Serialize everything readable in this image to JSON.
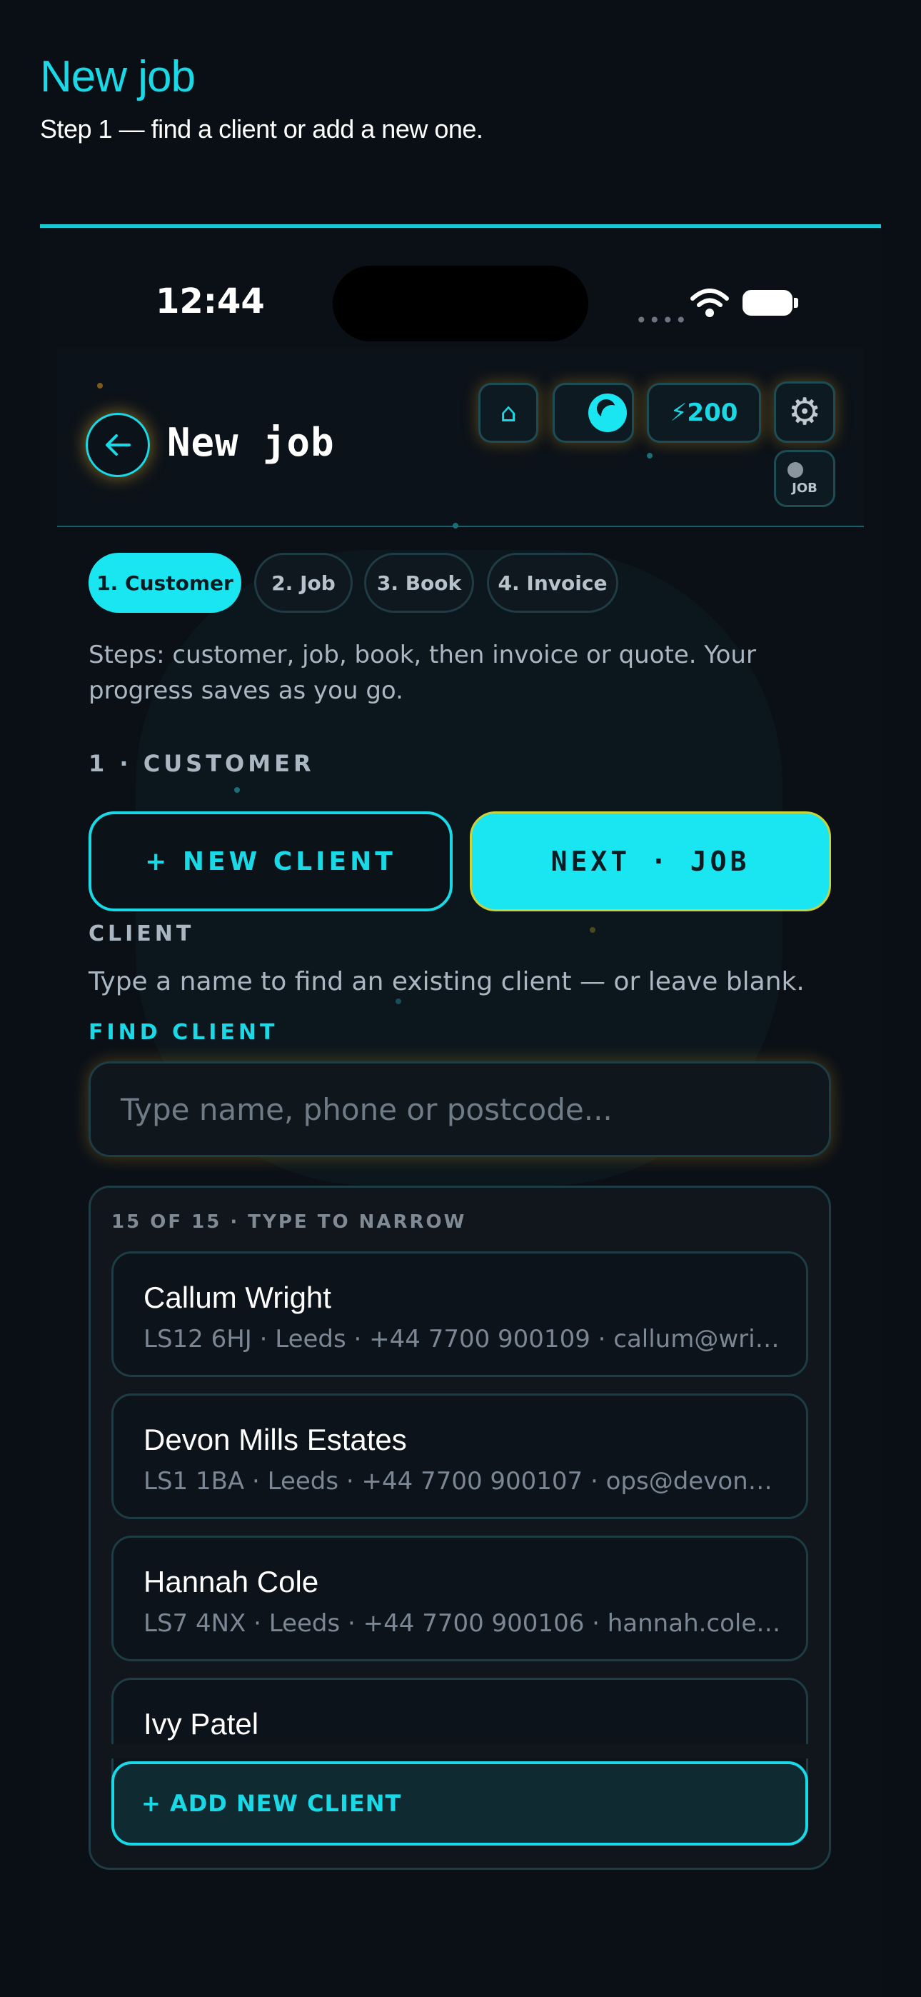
{
  "doc": {
    "title": "New job",
    "subtitle": "Step 1 — find a client or add a new one."
  },
  "status_bar": {
    "time": "12:44",
    "signal": "••••"
  },
  "header": {
    "title": "New job",
    "home_icon": "⌂",
    "credits": "⚡200",
    "gear_icon": "⚙",
    "job_toggle_label": "JOB"
  },
  "steps": {
    "items": [
      "1. Customer",
      "2. Job",
      "3. Book",
      "4. Invoice"
    ],
    "active_index": 0,
    "description": "Steps: customer, job, book, then invoice or quote. Your progress saves as you go."
  },
  "section": {
    "label": "1 · CUSTOMER"
  },
  "actions": {
    "new_client": "+ NEW CLIENT",
    "next": "NEXT · JOB"
  },
  "client": {
    "label": "CLIENT",
    "help": "Type a name to find an existing client — or leave blank.",
    "find_label": "FIND CLIENT",
    "search_placeholder": "Type name, phone or postcode..."
  },
  "results": {
    "count_label": "15 OF 15 · TYPE TO NARROW",
    "clients": [
      {
        "name": "Callum Wright",
        "details": "LS12 6HJ · Leeds · +44 7700 900109 · callum@wrig..."
      },
      {
        "name": "Devon Mills Estates",
        "details": "LS1 1BA · Leeds · +44 7700 900107 · ops@devonmill..."
      },
      {
        "name": "Hannah Cole",
        "details": "LS7 4NX · Leeds · +44 7700 900106 · hannah.cole@..."
      },
      {
        "name": "Ivy Patel",
        "details": ""
      }
    ],
    "add_button": "+ ADD NEW CLIENT"
  },
  "colors": {
    "accent": "#19e6f0",
    "background": "#0a0f16",
    "glow": "#e6aa1e"
  }
}
